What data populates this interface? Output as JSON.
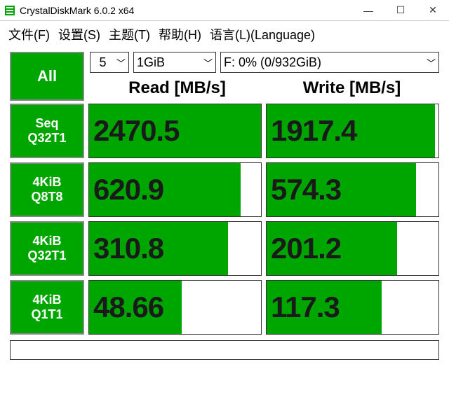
{
  "window": {
    "title": "CrystalDiskMark 6.0.2 x64",
    "min": "—",
    "max": "☐",
    "close": "✕"
  },
  "menu": {
    "file": "文件(F)",
    "settings": "设置(S)",
    "theme": "主题(T)",
    "help": "帮助(H)",
    "language": "语言(L)(Language)"
  },
  "controls": {
    "all_label": "All",
    "count": "5",
    "size": "1GiB",
    "drive": "F: 0% (0/932GiB)",
    "caret": "﹀"
  },
  "headers": {
    "read": "Read [MB/s]",
    "write": "Write [MB/s]"
  },
  "tests": [
    {
      "name_line1": "Seq",
      "name_line2": "Q32T1",
      "read": "2470.5",
      "write": "1917.4",
      "read_pct": 100,
      "write_pct": 98
    },
    {
      "name_line1": "4KiB",
      "name_line2": "Q8T8",
      "read": "620.9",
      "write": "574.3",
      "read_pct": 88,
      "write_pct": 87
    },
    {
      "name_line1": "4KiB",
      "name_line2": "Q32T1",
      "read": "310.8",
      "write": "201.2",
      "read_pct": 81,
      "write_pct": 76
    },
    {
      "name_line1": "4KiB",
      "name_line2": "Q1T1",
      "read": "48.66",
      "write": "117.3",
      "read_pct": 54,
      "write_pct": 67
    }
  ],
  "colors": {
    "green": "#00a600"
  }
}
